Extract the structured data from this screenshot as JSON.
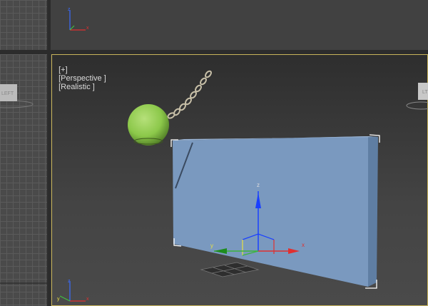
{
  "viewport_main": {
    "menu_plus": "[+]",
    "menu_view": "[Perspective ]",
    "menu_shading": "[Realistic ]"
  },
  "viewcube": {
    "left_label": "LEFT",
    "right_label": "LT"
  },
  "axes": {
    "x": "x",
    "y": "y",
    "z": "z"
  },
  "colors": {
    "active_border": "#c8b45a",
    "wall": "#7a99bf",
    "ball": "#8cc84a"
  }
}
